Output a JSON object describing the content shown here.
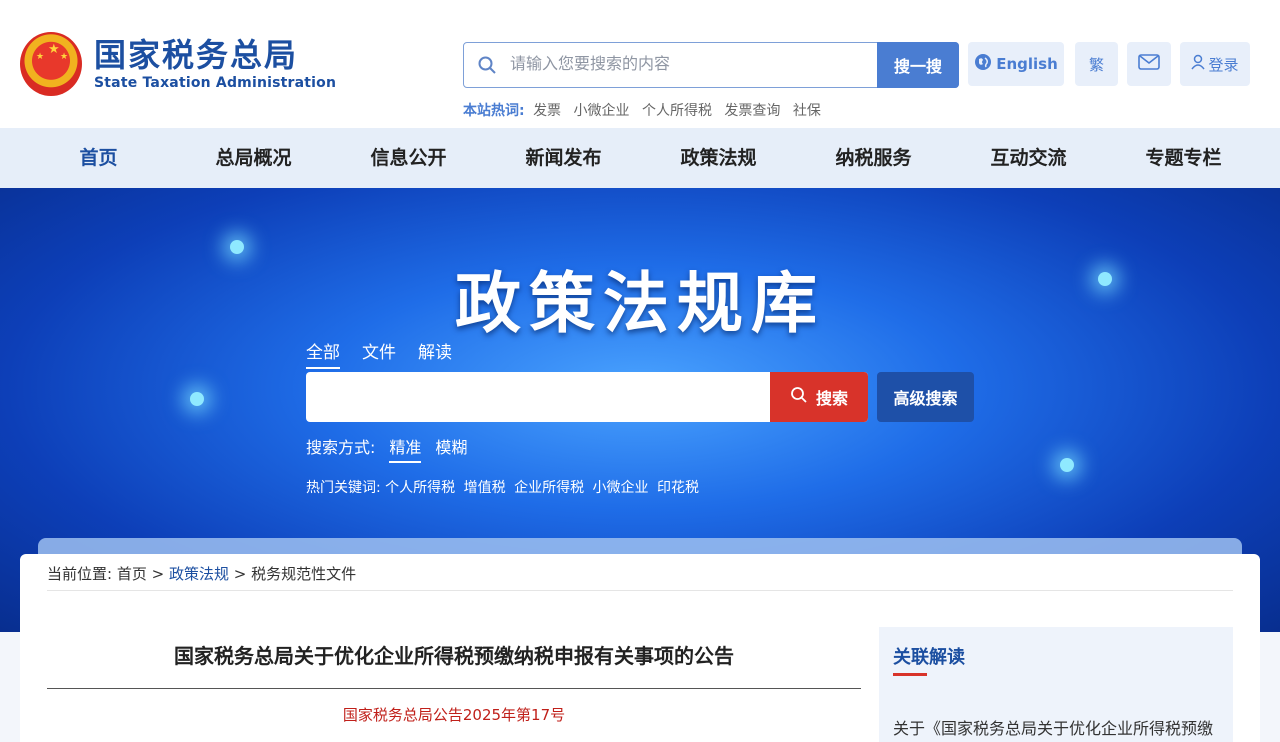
{
  "header": {
    "logo_cn": "国家税务总局",
    "logo_en": "State Taxation Administration",
    "search_placeholder": "请输入您要搜索的内容",
    "search_button": "搜一搜",
    "hot_label": "本站热词:",
    "hot_words": [
      "发票",
      "小微企业",
      "个人所得税",
      "发票查询",
      "社保"
    ],
    "english_label": "English",
    "traditional_label": "繁",
    "login_label": "登录"
  },
  "nav": {
    "items": [
      "首页",
      "总局概况",
      "信息公开",
      "新闻发布",
      "政策法规",
      "纳税服务",
      "互动交流",
      "专题专栏"
    ]
  },
  "banner": {
    "title": "政策法规库",
    "tabs": [
      "全部",
      "文件",
      "解读"
    ],
    "search_button": "搜索",
    "advanced_button": "高级搜索",
    "mode_label": "搜索方式:",
    "modes": [
      "精准",
      "模糊"
    ],
    "hot_label": "热门关键词:",
    "hot_words": [
      "个人所得税",
      "增值税",
      "企业所得税",
      "小微企业",
      "印花税"
    ]
  },
  "breadcrumb": {
    "label": "当前位置:",
    "items": [
      "首页",
      "政策法规",
      "税务规范性文件"
    ]
  },
  "article": {
    "title": "国家税务总局关于优化企业所得税预缴纳税申报有关事项的公告",
    "doc_no": "国家税务总局公告2025年第17号"
  },
  "sidebar": {
    "title": "关联解读",
    "items": [
      "关于《国家税务总局关于优化企业所得税预缴"
    ]
  },
  "colors": {
    "brand_blue": "#1c4fa1",
    "accent_blue": "#4a7dd2",
    "search_red": "#d8332a",
    "doc_no_red": "#c0201a"
  }
}
